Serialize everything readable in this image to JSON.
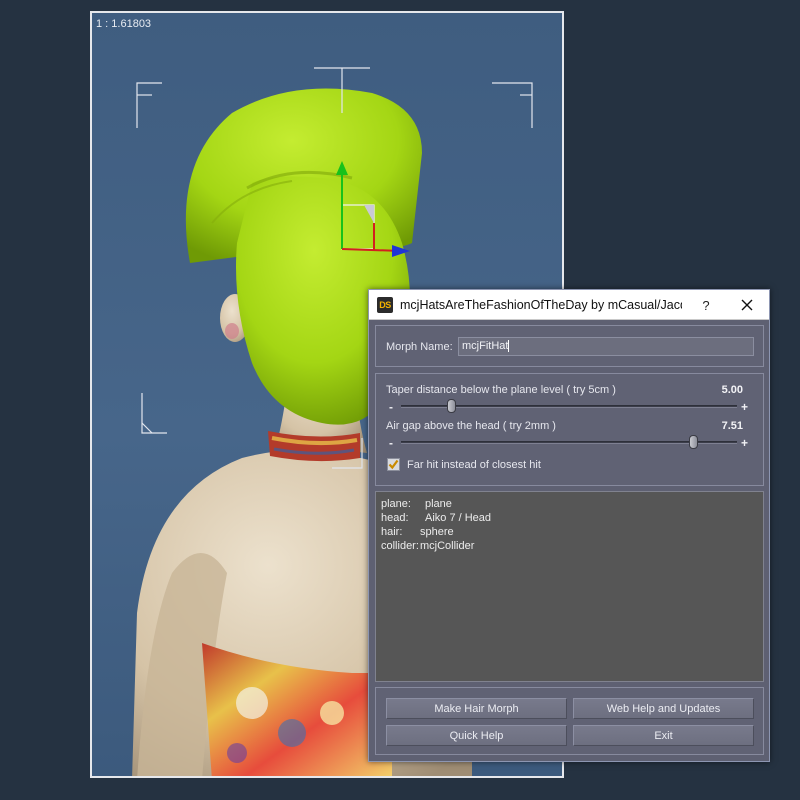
{
  "viewport": {
    "aspect_ratio_label": "1 : 1.61803"
  },
  "dialog": {
    "app_icon_text": "DS",
    "title": "mcjHatsAreTheFashionOfTheDay by mCasual/Jacq...",
    "help_label": "?",
    "morph_name": {
      "label": "Morph Name:",
      "value": "mcjFitHat"
    },
    "sliders": [
      {
        "label": "Taper distance below the plane level ( try 5cm )",
        "value_text": "5.00",
        "level": 0.14,
        "minus": "-",
        "plus": "+"
      },
      {
        "label": "Air gap above the head ( try 2mm )",
        "value_text": "7.51",
        "level": 0.88,
        "minus": "-",
        "plus": "+"
      }
    ],
    "far_hit": {
      "label": "Far hit instead of closest hit",
      "checked": true
    },
    "info": {
      "plane": {
        "key": "plane:",
        "value": "plane"
      },
      "head": {
        "key": "head:",
        "value": "Aiko 7 / Head"
      },
      "hair": {
        "key": "hair:",
        "value": "sphere"
      },
      "collider": {
        "key": "collider:",
        "value": "mcjCollider"
      }
    },
    "buttons": {
      "make_hair_morph": "Make Hair Morph",
      "web_help": "Web Help and Updates",
      "quick_help": "Quick Help",
      "exit": "Exit"
    }
  },
  "colors": {
    "hat": "#a8dc1a",
    "viewport_bg": "#44638a",
    "desktop_bg": "#253241",
    "dialog_bg": "#5e6072"
  },
  "icons": [
    "close-icon",
    "check-icon",
    "app-logo-icon"
  ]
}
